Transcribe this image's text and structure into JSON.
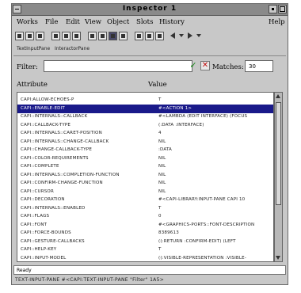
{
  "window": {
    "title": "Inspector 1"
  },
  "menu": [
    "Works",
    "File",
    "Edit",
    "View",
    "Object",
    "Slots",
    "History",
    "Help"
  ],
  "tabs": [
    "TextInputPane",
    "InteractorPane"
  ],
  "filter": {
    "label": "Filter:",
    "value": ""
  },
  "matches": {
    "label": "Matches:",
    "value": "30"
  },
  "columns": {
    "attribute": "Attribute",
    "value": "Value"
  },
  "rows": [
    {
      "attribute": "CAPI:ALLOW-ECHOES-P",
      "value": "T"
    },
    {
      "attribute": "CAPI::ENABLE-EDIT",
      "value": "#<ACTION 1>"
    },
    {
      "attribute": "CAPI::INTERNALS::CALLBACK",
      "value": "#<LAMBDA (EDIT INTERFACE) (FOCUS"
    },
    {
      "attribute": "CAPI::CALLBACK-TYPE",
      "value": "(:DATA :INTERFACE)"
    },
    {
      "attribute": "CAPI::INTERNALS::CARET-POSITION",
      "value": "4"
    },
    {
      "attribute": "CAPI::INTERNALS::CHANGE-CALLBACK",
      "value": "NIL"
    },
    {
      "attribute": "CAPI::CHANGE-CALLBACK-TYPE",
      "value": ":DATA"
    },
    {
      "attribute": "CAPI::COLOR-REQUIREMENTS",
      "value": "NIL"
    },
    {
      "attribute": "CAPI::COMPLETE",
      "value": "NIL"
    },
    {
      "attribute": "CAPI::INTERNALS::COMPLETION-FUNCTION",
      "value": "NIL"
    },
    {
      "attribute": "CAPI::CONFIRM-CHANGE-FUNCTION",
      "value": "NIL"
    },
    {
      "attribute": "CAPI::CURSOR",
      "value": "NIL"
    },
    {
      "attribute": "CAPI::DECORATION",
      "value": "#<CAPI-LIBRARY:INPUT-PANE CAPI 10"
    },
    {
      "attribute": "CAPI::INTERNALS::ENABLED",
      "value": "T"
    },
    {
      "attribute": "CAPI::FLAGS",
      "value": "0"
    },
    {
      "attribute": "CAPI::FONT",
      "value": "#<GRAPHICS-PORTS::FONT-DESCRIPTION"
    },
    {
      "attribute": "CAPI::FORCE-BOUNDS",
      "value": "8389613"
    },
    {
      "attribute": "CAPI::GESTURE-CALLBACKS",
      "value": "((:RETURN :CONFIRM-EDIT) (LEFT"
    },
    {
      "attribute": "CAPI::HELP-KEY",
      "value": "T"
    },
    {
      "attribute": "CAPI::INPUT-MODEL",
      "value": "((:VISIBLE-REPRESENTATION :VISIBLE-"
    }
  ],
  "status": "Ready",
  "info": "TEXT-INPUT-PANE   #<CAPI:TEXT-INPUT-PANE   \"Filter\" 1A5>"
}
